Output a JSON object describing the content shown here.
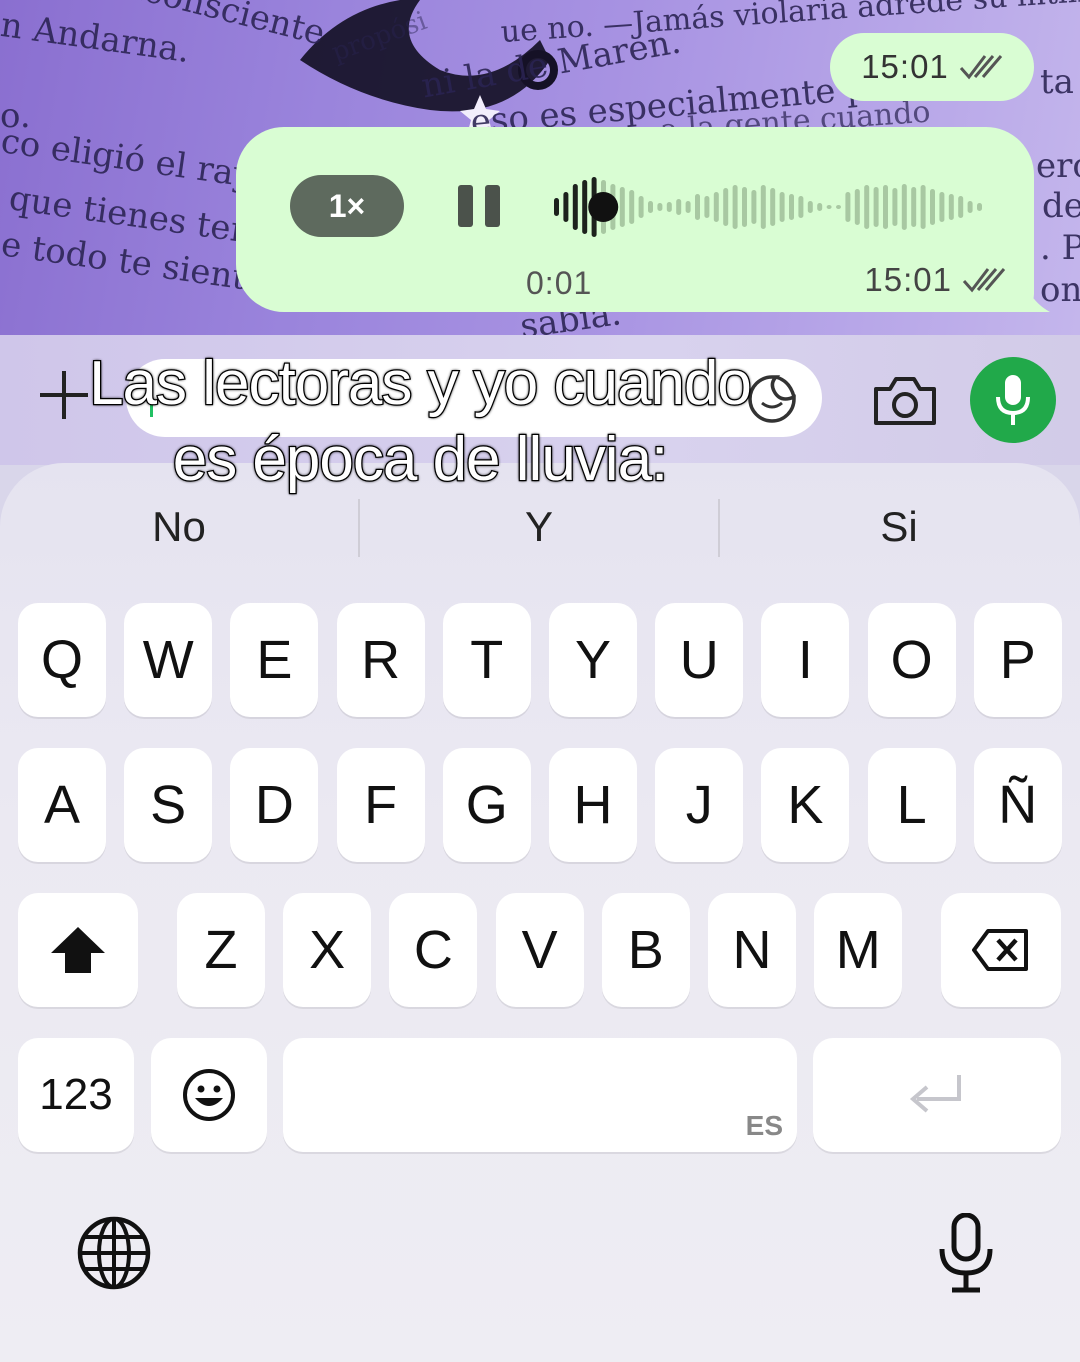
{
  "background": {
    "book_lines": [
      "inconsciente",
      "n Andarna.",
      "o.",
      "co eligió el rayo",
      "que tienes tende",
      "e todo te sientes a",
      "propósi",
      "ue no. —Jamás violaría adrede su intimidad",
      "ni la de Maren.",
      "eso es especialmente pel",
      "ta la",
      "a la gente cuando",
      "ero",
      "de",
      ". Pr",
      "on",
      "sabía."
    ]
  },
  "chat": {
    "sent_message": {
      "time": "15:01",
      "status_icon": "double-check-icon"
    },
    "voice_message": {
      "speed": "1×",
      "state_icon": "pause-icon",
      "progress": 0.1,
      "duration": "0:01",
      "time": "15:01",
      "status_icon": "double-check-icon"
    }
  },
  "caption": {
    "line1": "Las lectoras y yo cuando",
    "line2": "es época de lluvia:"
  },
  "input_bar": {
    "text": "",
    "icons": [
      "plus-icon",
      "sticker-icon",
      "camera-icon",
      "microphone-icon"
    ],
    "accent_color": "#21a94a"
  },
  "keyboard": {
    "suggestions": [
      "No",
      "Y",
      "Si"
    ],
    "row1": [
      "Q",
      "W",
      "E",
      "R",
      "T",
      "Y",
      "U",
      "I",
      "O",
      "P"
    ],
    "row2": [
      "A",
      "S",
      "D",
      "F",
      "G",
      "H",
      "J",
      "K",
      "L",
      "Ñ"
    ],
    "row3": [
      "Z",
      "X",
      "C",
      "V",
      "B",
      "N",
      "M"
    ],
    "numbers_key": "123",
    "language": "ES",
    "icons": [
      "shift-icon",
      "backspace-icon",
      "emoji-icon",
      "return-icon",
      "globe-icon",
      "dictation-icon"
    ]
  }
}
